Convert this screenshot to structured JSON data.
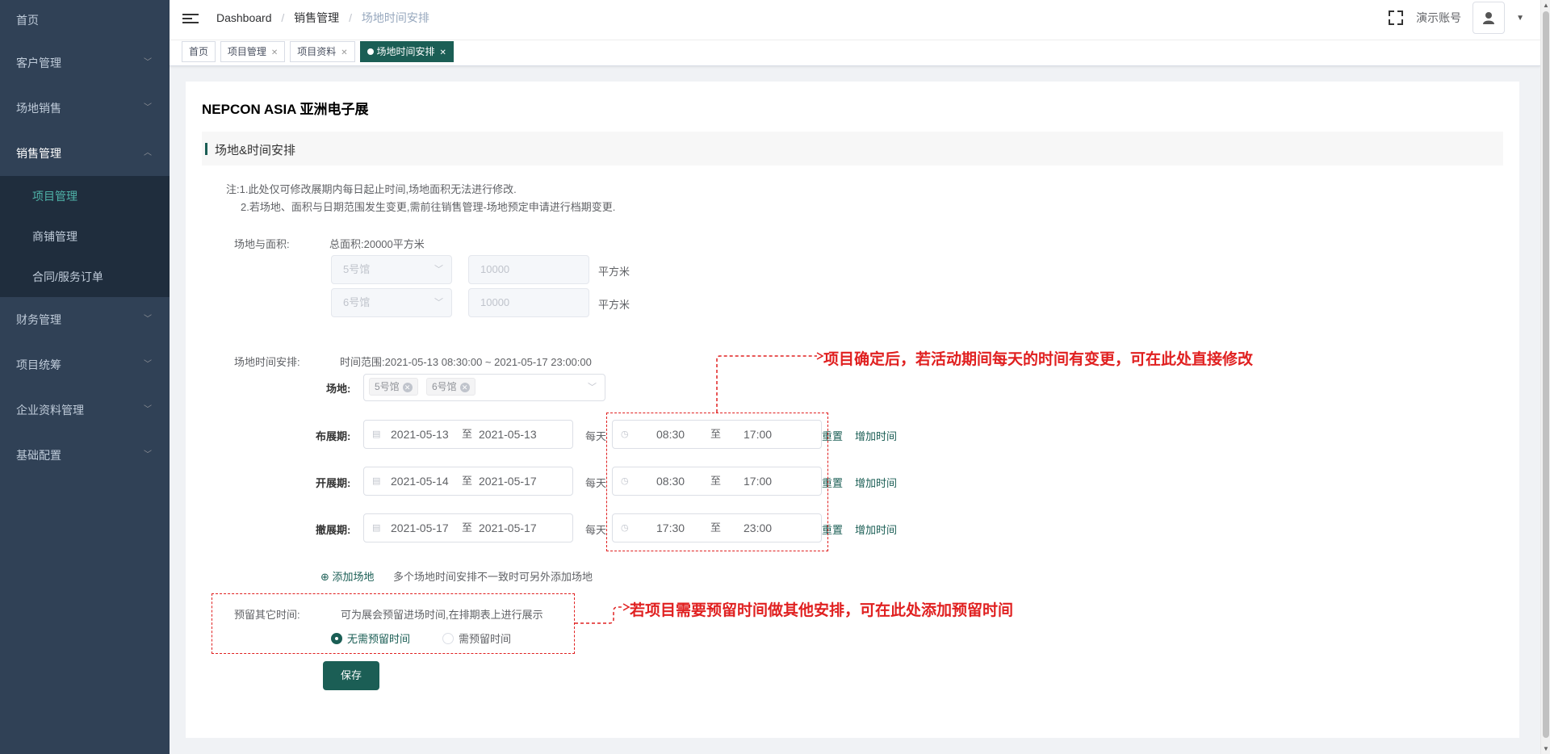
{
  "sidebar": {
    "items": [
      {
        "label": "首页"
      },
      {
        "label": "客户管理"
      },
      {
        "label": "场地销售"
      },
      {
        "label": "销售管理"
      },
      {
        "label": "财务管理"
      },
      {
        "label": "项目统筹"
      },
      {
        "label": "企业资料管理"
      },
      {
        "label": "基础配置"
      }
    ],
    "sub_items": [
      {
        "label": "项目管理"
      },
      {
        "label": "商铺管理"
      },
      {
        "label": "合同/服务订单"
      }
    ]
  },
  "header": {
    "breadcrumb": [
      "Dashboard",
      "销售管理",
      "场地时间安排"
    ],
    "account_label": "演示账号"
  },
  "tags": [
    {
      "label": "首页"
    },
    {
      "label": "项目管理"
    },
    {
      "label": "项目资料"
    },
    {
      "label": "场地时间安排"
    }
  ],
  "main": {
    "title": "NEPCON ASIA 亚洲电子展",
    "section_title": "场地&时间安排",
    "notes": [
      "注:1.此处仅可修改展期内每日起止时间,场地面积无法进行修改.",
      "2.若场地、面积与日期范围发生变更,需前往销售管理-场地预定申请进行档期变更."
    ],
    "venue_area_label": "场地与面积:",
    "total_area": "总面积:20000平方米",
    "venues": [
      {
        "hall": "5号馆",
        "area": "10000",
        "unit": "平方米"
      },
      {
        "hall": "6号馆",
        "area": "10000",
        "unit": "平方米"
      }
    ],
    "schedule_label": "场地时间安排:",
    "time_range": "时间范围:2021-05-13 08:30:00 ~ 2021-05-17 23:00:00",
    "venue_select_label": "场地:",
    "selected_venues": [
      "5号馆",
      "6号馆"
    ],
    "periods": [
      {
        "label": "布展期:",
        "start_date": "2021-05-13",
        "end_date": "2021-05-13",
        "start_time": "08:30",
        "end_time": "17:00"
      },
      {
        "label": "开展期:",
        "start_date": "2021-05-14",
        "end_date": "2021-05-17",
        "start_time": "08:30",
        "end_time": "17:00"
      },
      {
        "label": "撤展期:",
        "start_date": "2021-05-17",
        "end_date": "2021-05-17",
        "start_time": "17:30",
        "end_time": "23:00"
      }
    ],
    "to_label": "至",
    "daily_label": "每天",
    "reset_label": "重置",
    "add_time_label": "增加时间",
    "add_venue_label": "添加场地",
    "add_venue_hint": "多个场地时间安排不一致时可另外添加场地",
    "reserve_label": "预留其它时间:",
    "reserve_hint": "可为展会预留进场时间,在排期表上进行展示",
    "reserve_options": [
      "无需预留时间",
      "需预留时间"
    ],
    "save_label": "保存"
  },
  "annotations": {
    "top": "项目确定后，若活动期间每天的时间有变更，可在此处直接修改",
    "bottom": "若项目需要预留时间做其他安排，可在此处添加预留时间"
  }
}
